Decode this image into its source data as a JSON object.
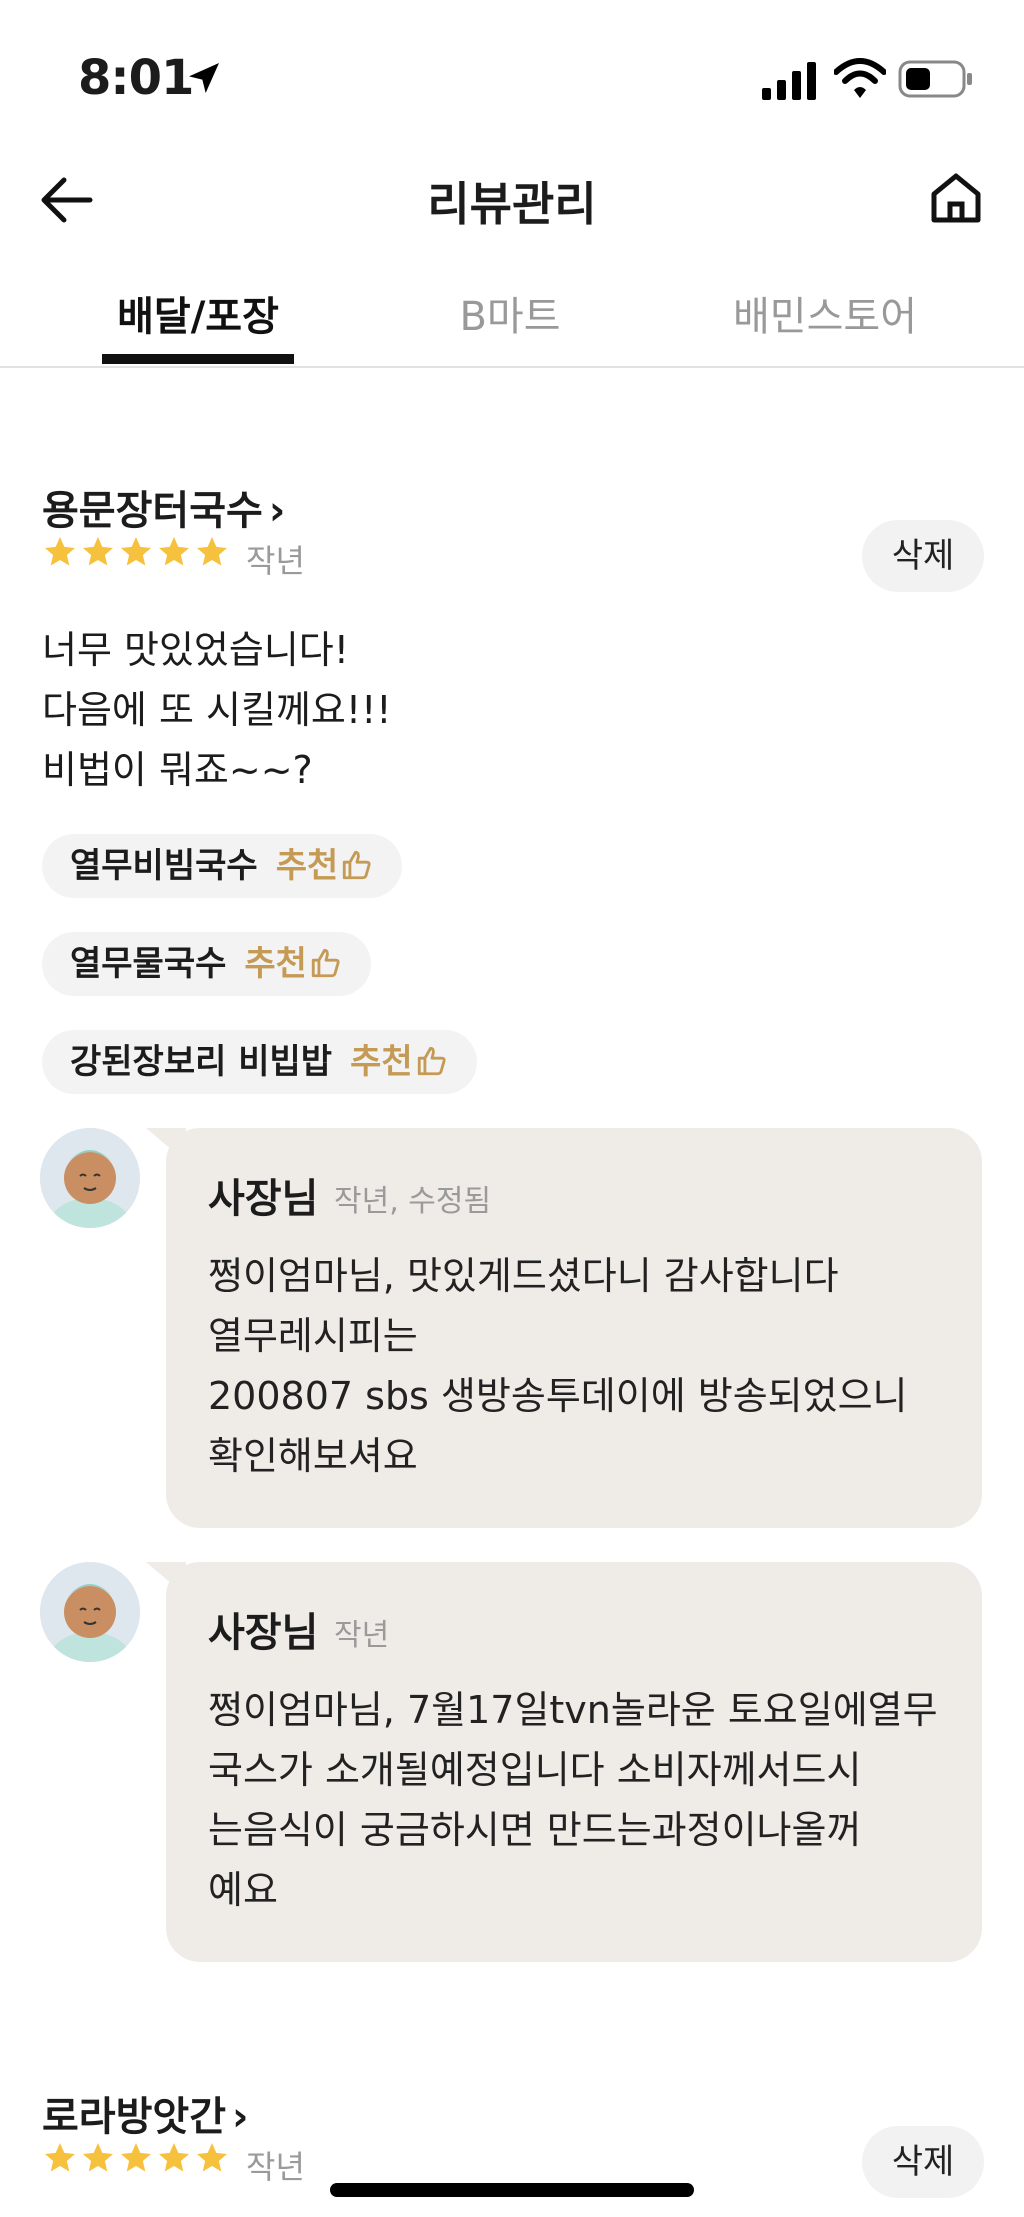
{
  "status_bar": {
    "time": "8:01",
    "icons": [
      "location-arrow-icon",
      "signal-icon",
      "wifi-icon",
      "battery-icon"
    ]
  },
  "header": {
    "title": "리뷰관리",
    "back_icon": "back-arrow-icon",
    "home_icon": "home-icon"
  },
  "tabs": [
    {
      "label": "배달/포장",
      "active": true
    },
    {
      "label": "B마트",
      "active": false
    },
    {
      "label": "배민스토어",
      "active": false
    }
  ],
  "reviews": [
    {
      "store": "용문장터국수",
      "rating": 5,
      "date": "작년",
      "delete_label": "삭제",
      "text_lines": [
        "너무 맛있었습니다!",
        "다음에 또 시킬께요!!!",
        "비법이 뭐죠~~?"
      ],
      "menus": [
        {
          "name": "열무비빔국수",
          "rec": "추천"
        },
        {
          "name": "열무물국수",
          "rec": "추천"
        },
        {
          "name": "강된장보리 비빕밥",
          "rec": "추천"
        }
      ],
      "replies": [
        {
          "author": "사장님",
          "date": "작년, 수정됨",
          "lines": [
            "쩡이엄마님, 맛있게드셨다니 감사합니다",
            "열무레시피는",
            "200807 sbs 생방송투데이에 방송되었으니",
            "확인해보셔요"
          ]
        },
        {
          "author": "사장님",
          "date": "작년",
          "lines": [
            "쩡이엄마님, 7월17일tvn놀라운 토요일에열무",
            "국스가  소개될예정입니다    소비자께서드시",
            "는음식이  궁금하시면  만드는과정이나올꺼",
            "예요"
          ]
        }
      ]
    },
    {
      "store": "로라방앗간",
      "rating": 5,
      "date": "작년",
      "delete_label": "삭제"
    }
  ],
  "colors": {
    "star": "#f6c23e",
    "recommend": "#c49a55",
    "reply_bg": "#efece8",
    "tag_bg": "#f3f3f3"
  }
}
